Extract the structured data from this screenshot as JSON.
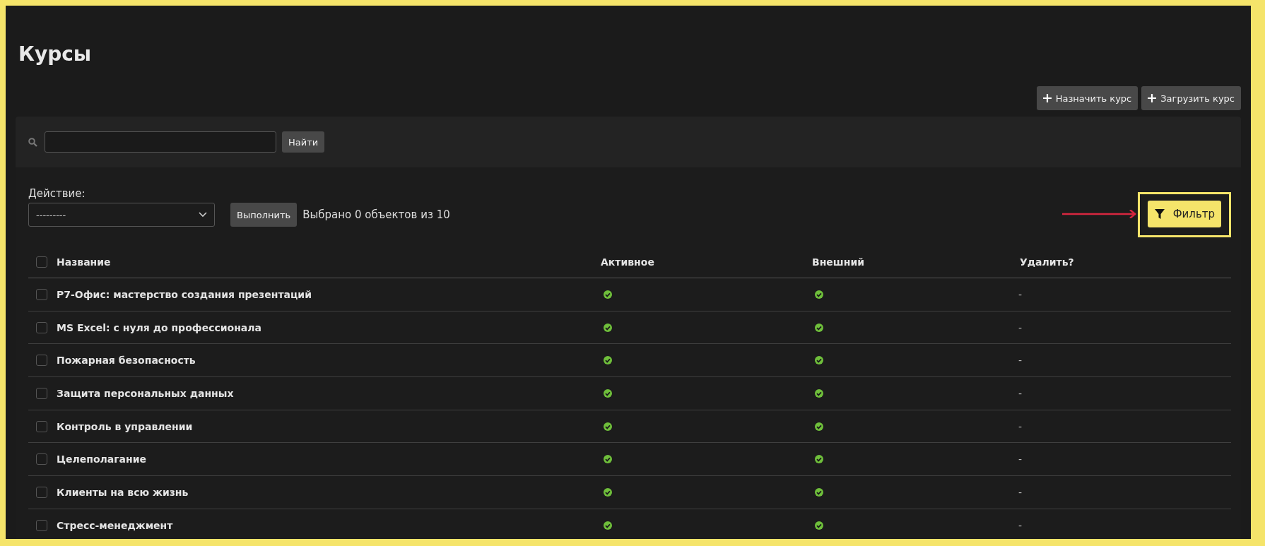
{
  "page": {
    "title": "Курсы"
  },
  "toolbar_buttons": [
    {
      "label": "Назначить курс"
    },
    {
      "label": "Загрузить курс"
    }
  ],
  "search": {
    "button": "Найти"
  },
  "actions": {
    "label": "Действие:",
    "select_value": "---------",
    "run_button": "Выполнить",
    "selection_info": "Выбрано 0 объектов из 10"
  },
  "filter_button": {
    "label": "Фильтр",
    "highlighted": true
  },
  "table": {
    "select_all_checked": false,
    "columns": [
      {
        "label": "Название",
        "kind": "text"
      },
      {
        "label": "Активное",
        "kind": "bool"
      },
      {
        "label": "Внешний",
        "kind": "bool"
      },
      {
        "label": "Удалить?",
        "kind": "text"
      }
    ],
    "rows": [
      {
        "checked": false,
        "cells": [
          {
            "text": "Р7-Офис: мастерство создания презентаций"
          },
          {
            "value": true
          },
          {
            "value": true
          },
          {
            "text": "-"
          }
        ]
      },
      {
        "checked": false,
        "cells": [
          {
            "text": "MS Excel: с нуля до профессионала"
          },
          {
            "value": true
          },
          {
            "value": true
          },
          {
            "text": "-"
          }
        ]
      },
      {
        "checked": false,
        "cells": [
          {
            "text": "Пожарная безопасность"
          },
          {
            "value": true
          },
          {
            "value": true
          },
          {
            "text": "-"
          }
        ]
      },
      {
        "checked": false,
        "cells": [
          {
            "text": "Защита персональных данных"
          },
          {
            "value": true
          },
          {
            "value": true
          },
          {
            "text": "-"
          }
        ]
      },
      {
        "checked": false,
        "cells": [
          {
            "text": "Контроль в управлении"
          },
          {
            "value": true
          },
          {
            "value": true
          },
          {
            "text": "-"
          }
        ]
      },
      {
        "checked": false,
        "cells": [
          {
            "text": "Целеполагание"
          },
          {
            "value": true
          },
          {
            "value": true
          },
          {
            "text": "-"
          }
        ]
      },
      {
        "checked": false,
        "cells": [
          {
            "text": "Клиенты на всю жизнь"
          },
          {
            "value": true
          },
          {
            "value": true
          },
          {
            "text": "-"
          }
        ]
      },
      {
        "checked": false,
        "cells": [
          {
            "text": "Стресс-менеджмент"
          },
          {
            "value": true
          },
          {
            "value": true
          },
          {
            "text": "-"
          }
        ]
      }
    ]
  }
}
